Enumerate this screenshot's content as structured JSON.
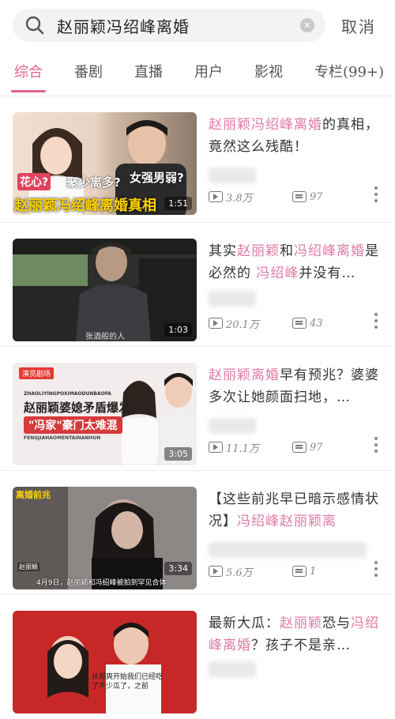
{
  "search": {
    "query": "赵丽颖冯绍峰离婚",
    "cancel_label": "取消"
  },
  "tabs": [
    "综合",
    "番剧",
    "直播",
    "用户",
    "影视",
    "专栏(99+)"
  ],
  "active_tab": 0,
  "colors": {
    "accent": "#e4618a",
    "highlight": "#e07aa3"
  },
  "items": [
    {
      "title_parts": [
        {
          "text": "赵丽颖冯绍峰离婚",
          "hl": true
        },
        {
          "text": "的真相，竟然这么残酷！",
          "hl": false
        }
      ],
      "duration": "1:51",
      "views": "3.8万",
      "comments": "97",
      "thumb_text": [
        "花心?",
        "聚少离多?",
        "女强男弱?",
        "赵丽颖冯绍峰离婚真相"
      ]
    },
    {
      "title_parts": [
        {
          "text": "其实",
          "hl": false
        },
        {
          "text": "赵丽颖",
          "hl": true
        },
        {
          "text": "和",
          "hl": false
        },
        {
          "text": "冯绍峰离婚",
          "hl": true
        },
        {
          "text": "是必然的 ",
          "hl": false
        },
        {
          "text": "冯绍峰",
          "hl": true
        },
        {
          "text": "并没有…",
          "hl": false
        }
      ],
      "duration": "1:03",
      "views": "20.1万",
      "comments": "43",
      "thumb_text": [
        "张酒般的人"
      ]
    },
    {
      "title_parts": [
        {
          "text": "赵丽颖离婚",
          "hl": true
        },
        {
          "text": "早有预兆？婆婆多次让她颜面扫地，…",
          "hl": false
        }
      ],
      "duration": "3:05",
      "views": "11.1万",
      "comments": "97",
      "thumb_text": [
        "演员剧场",
        "ZHAOLIYINGPOXIMAODUNBAOFA",
        "赵丽颖婆媳矛盾爆发?",
        "\"冯家\"豪门太难混",
        "FENGJIAHAOMENTAINANHUN"
      ]
    },
    {
      "title_parts": [
        {
          "text": "【这些前兆早已暗示感情状况】",
          "hl": false
        },
        {
          "text": "冯绍峰赵丽颖离",
          "hl": true
        }
      ],
      "duration": "3:34",
      "views": "5.6万",
      "comments": "1",
      "thumb_text": [
        "离婚前兆",
        "赵丽颖",
        "4月9日，赵丽颖和冯绍峰被拍到罕见合体"
      ]
    },
    {
      "title_parts": [
        {
          "text": "最新大瓜：",
          "hl": false
        },
        {
          "text": "赵丽颖",
          "hl": true
        },
        {
          "text": "恐与",
          "hl": false
        },
        {
          "text": "冯绍峰离婚",
          "hl": true
        },
        {
          "text": "？孩子不是亲…",
          "hl": false
        }
      ],
      "duration": "",
      "views": "",
      "comments": "",
      "thumb_text": [
        "从郑爽开始我们已经吃了不少瓜了，之前"
      ]
    }
  ]
}
